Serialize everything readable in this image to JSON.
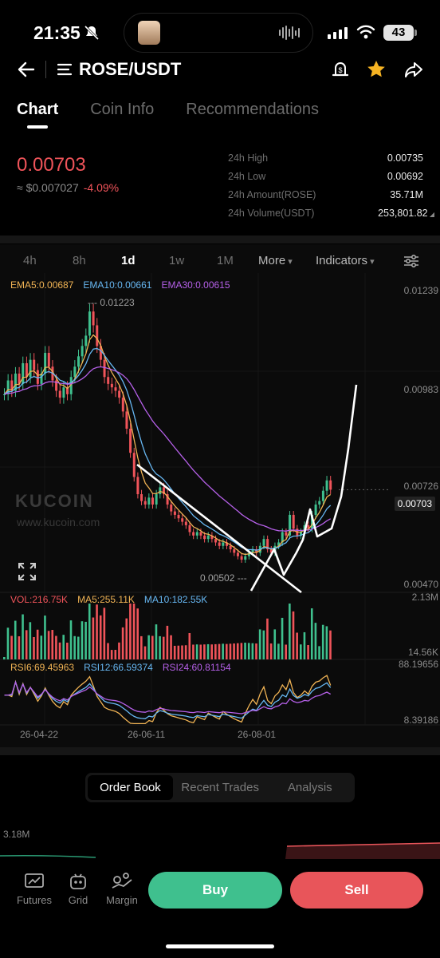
{
  "status_bar": {
    "time": "21:35",
    "battery": "43"
  },
  "header": {
    "pair": "ROSE/USDT"
  },
  "tabs": [
    {
      "label": "Chart",
      "active": true
    },
    {
      "label": "Coin Info",
      "active": false
    },
    {
      "label": "Recommendations",
      "active": false
    }
  ],
  "price": {
    "last": "0.00703",
    "usd": "≈ $0.007027",
    "change": "-4.09%",
    "up_color": "#3fc08e",
    "down_color": "#f0545a"
  },
  "stats": [
    {
      "label": "24h High",
      "value": "0.00735"
    },
    {
      "label": "24h Low",
      "value": "0.00692"
    },
    {
      "label": "24h Amount(ROSE)",
      "value": "35.71M"
    },
    {
      "label": "24h Volume(USDT)",
      "value": "253,801.82"
    }
  ],
  "timeframes": {
    "t4h": "4h",
    "t8h": "8h",
    "t1d": "1d",
    "t1w": "1w",
    "t1M": "1M",
    "more": "More",
    "indicators": "Indicators",
    "active": "1d"
  },
  "legends": {
    "ema5": "EMA5:0.00687",
    "ema10": "EMA10:0.00661",
    "ema30": "EMA30:0.00615",
    "vol": "VOL:216.75K",
    "ma5": "MA5:255.11K",
    "ma10": "MA10:182.55K",
    "rsi6": "RSI6:69.45963",
    "rsi12": "RSI12:66.59374",
    "rsi24": "RSI24:60.81154"
  },
  "axes": {
    "price_top": "0.01239",
    "price_2": "0.00983",
    "price_3": "0.00726",
    "price_low": "0.00470",
    "current": "0.00703",
    "vol_max": "2.13M",
    "vol_min": "14.56K",
    "rsi_max": "88.19656",
    "rsi_min": "8.39186",
    "dates": [
      "26-04-22",
      "26-06-11",
      "26-08-01"
    ]
  },
  "annotations": {
    "high": "--- 0.01223",
    "low": "0.00502 ---"
  },
  "watermark": {
    "brand": "KUCOIN",
    "url": "www.kucoin.com"
  },
  "bottom_tabs": [
    {
      "label": "Order Book",
      "active": true
    },
    {
      "label": "Recent Trades",
      "active": false
    },
    {
      "label": "Analysis",
      "active": false
    }
  ],
  "depth": {
    "label": "3.18M"
  },
  "nav": {
    "futures": "Futures",
    "grid": "Grid",
    "margin": "Margin"
  },
  "actions": {
    "buy": "Buy",
    "sell": "Sell"
  },
  "chart_data": {
    "type": "candlestick",
    "x_ticks": [
      "26-04-22",
      "26-06-11",
      "26-08-01"
    ],
    "y_ticks": [
      0.01239,
      0.00983,
      0.00726,
      0.0047
    ],
    "ylim": [
      0.0047,
      0.01239
    ],
    "close": [
      0.0098,
      0.0102,
      0.0099,
      0.0104,
      0.0101,
      0.0107,
      0.0103,
      0.0108,
      0.0105,
      0.0101,
      0.0104,
      0.011,
      0.0106,
      0.0102,
      0.0099,
      0.0097,
      0.01,
      0.0098,
      0.0103,
      0.0106,
      0.0109,
      0.0112,
      0.0115,
      0.0122,
      0.0118,
      0.0112,
      0.0108,
      0.0103,
      0.0101,
      0.01,
      0.0099,
      0.0097,
      0.0093,
      0.0088,
      0.0081,
      0.0074,
      0.0069,
      0.0067,
      0.0066,
      0.0068,
      0.0066,
      0.0069,
      0.0071,
      0.0069,
      0.0066,
      0.0064,
      0.0063,
      0.0062,
      0.0061,
      0.006,
      0.0058,
      0.0057,
      0.0058,
      0.0057,
      0.0056,
      0.0057,
      0.0056,
      0.0055,
      0.0054,
      0.0055,
      0.0054,
      0.0053,
      0.0052,
      0.0051,
      0.005,
      0.0051,
      0.0052,
      0.0053,
      0.0052,
      0.0054,
      0.0056,
      0.0053,
      0.0052,
      0.0054,
      0.0055,
      0.0058,
      0.0057,
      0.0063,
      0.0059,
      0.0057,
      0.0058,
      0.006,
      0.0059,
      0.0063,
      0.0066,
      0.0067,
      0.007,
      0.0073,
      0.00703
    ],
    "ema5_last": 0.00687,
    "ema10_last": 0.00661,
    "ema30_last": 0.00615,
    "volume_last": 216750,
    "ma5_last": 255110,
    "ma10_last": 182550,
    "vol_range": [
      14560,
      2130000
    ],
    "rsi": {
      "rsi6": 69.45963,
      "rsi12": 66.59374,
      "rsi24": 60.81154,
      "range": [
        8.39186,
        88.19656
      ]
    },
    "annotations": {
      "high": 0.01223,
      "low": 0.00502,
      "current": 0.00703
    }
  }
}
